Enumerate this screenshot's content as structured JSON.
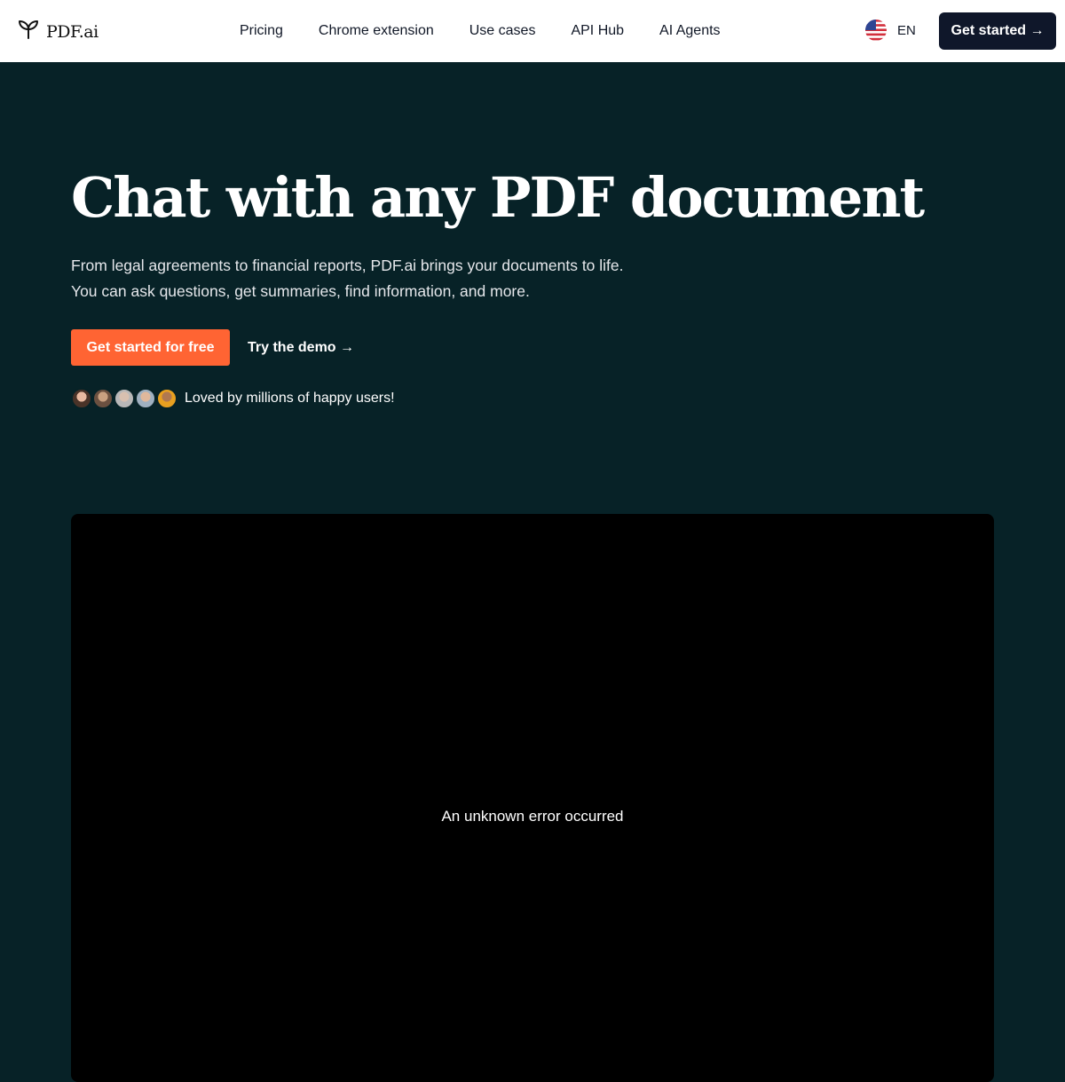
{
  "nav": {
    "logo_text": "PDF.ai",
    "links": [
      "Pricing",
      "Chrome extension",
      "Use cases",
      "API Hub",
      "AI Agents"
    ],
    "language": "EN",
    "cta": "Get started →"
  },
  "hero": {
    "title": "Chat with any PDF document",
    "subtitle_line1": "From legal agreements to financial reports, PDF.ai brings your documents to life.",
    "subtitle_line2": "You can ask questions, get summaries, find information, and more.",
    "primary_button": "Get started for free",
    "demo_button": "Try the demo →",
    "social_proof": "Loved by millions of happy users!"
  },
  "video": {
    "error_message": "An unknown error occurred"
  },
  "colors": {
    "background": "#072227",
    "primary_button": "#ff6433",
    "nav_cta": "#0f172a"
  }
}
